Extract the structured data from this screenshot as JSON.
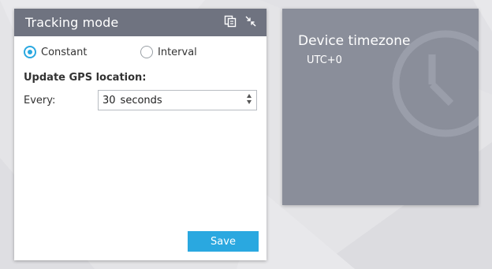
{
  "panel": {
    "title": "Tracking mode",
    "icons": [
      "copy-icon",
      "collapse-icon"
    ]
  },
  "mode": {
    "options": [
      {
        "label": "Constant",
        "selected": true
      },
      {
        "label": "Interval",
        "selected": false
      }
    ]
  },
  "gps": {
    "section_label": "Update GPS location:",
    "every_label": "Every:",
    "value": "30",
    "unit": "seconds"
  },
  "actions": {
    "save_label": "Save"
  },
  "timezone": {
    "title": "Device timezone",
    "value": "UTC+0",
    "icon": "clock-icon"
  },
  "colors": {
    "header_bg": "#6f7380",
    "accent": "#2aa8e0",
    "tile_bg": "#8a8e9a",
    "page_bg": "#e3e3e6"
  }
}
